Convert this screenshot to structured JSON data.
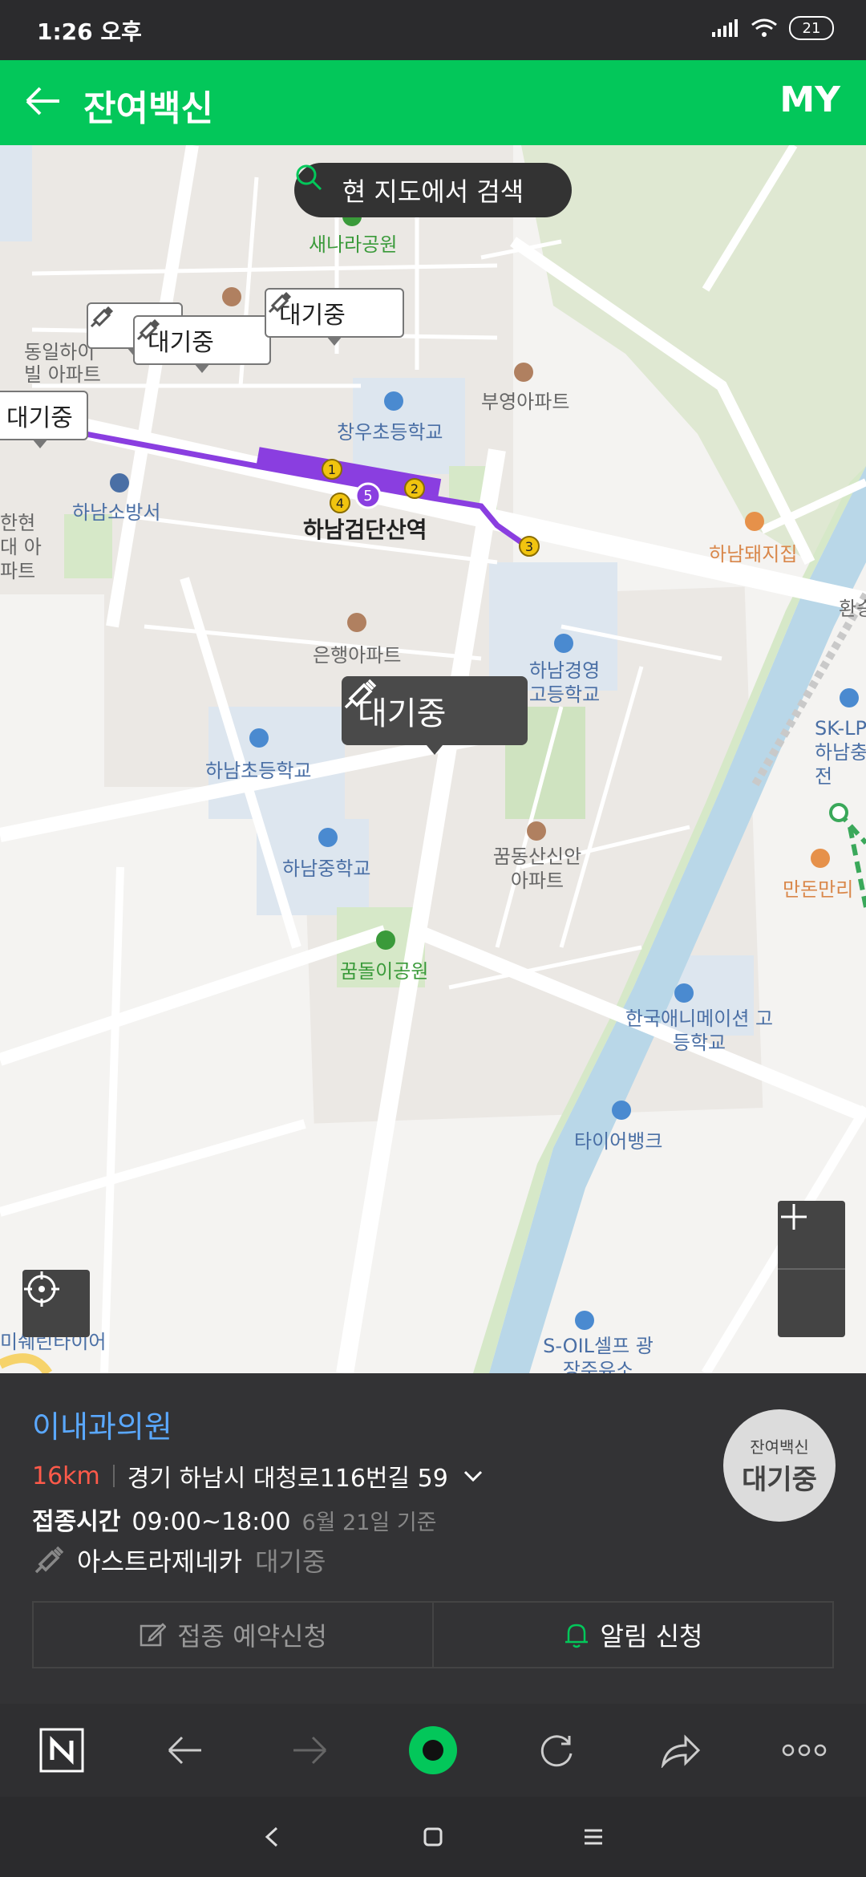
{
  "status": {
    "time": "1:26 오후",
    "battery": "21"
  },
  "header": {
    "title": "잔여백신",
    "my": "MY"
  },
  "map": {
    "search_label": "현 지도에서 검색",
    "markers": [
      "대기중",
      "대기중",
      "대기중",
      "대기중",
      "대기중"
    ],
    "places": {
      "park1": "새나라공원",
      "apt1": "동일하이빌 아파트",
      "apt2": "부영아파트",
      "school1": "창우초등학교",
      "fire": "하남소방서",
      "station": "하남검단산역",
      "hyundai": "한현대 아파트",
      "restaurant1": "하남돼지집",
      "apt3": "은행아파트",
      "school2": "하남경영 고등학교",
      "school3": "하남초등학교",
      "school4": "하남중학교",
      "apt4": "꿈동산신안 아파트",
      "park2": "꿈돌이공원",
      "school5": "한국애니메이션 고등학교",
      "tire": "타이어뱅크",
      "gas": "SK-LP 하남충전",
      "restaurant2": "만돈만리",
      "gas2": "S-OIL셀프 광장주유소",
      "tire2": "미쉐린타이어",
      "transfer": "환승"
    },
    "line5_stops": [
      "1",
      "2",
      "3",
      "4",
      "5"
    ]
  },
  "info": {
    "name": "이내과의원",
    "distance": "16km",
    "address": "경기 하남시 대청로116번길 59",
    "hours_label": "접종시간",
    "hours": "09:00~18:00",
    "hours_basis": "6월 21일 기준",
    "vaccine": "아스트라제네카",
    "vaccine_status": "대기중",
    "badge_small": "잔여백신",
    "badge_big": "대기중",
    "btn_reserve": "접종 예약신청",
    "btn_alert": "알림 신청"
  },
  "colors": {
    "brand": "#03c75a",
    "line5": "#8a3ee0",
    "link": "#5aa8ff",
    "distance": "#ff5a4a"
  }
}
